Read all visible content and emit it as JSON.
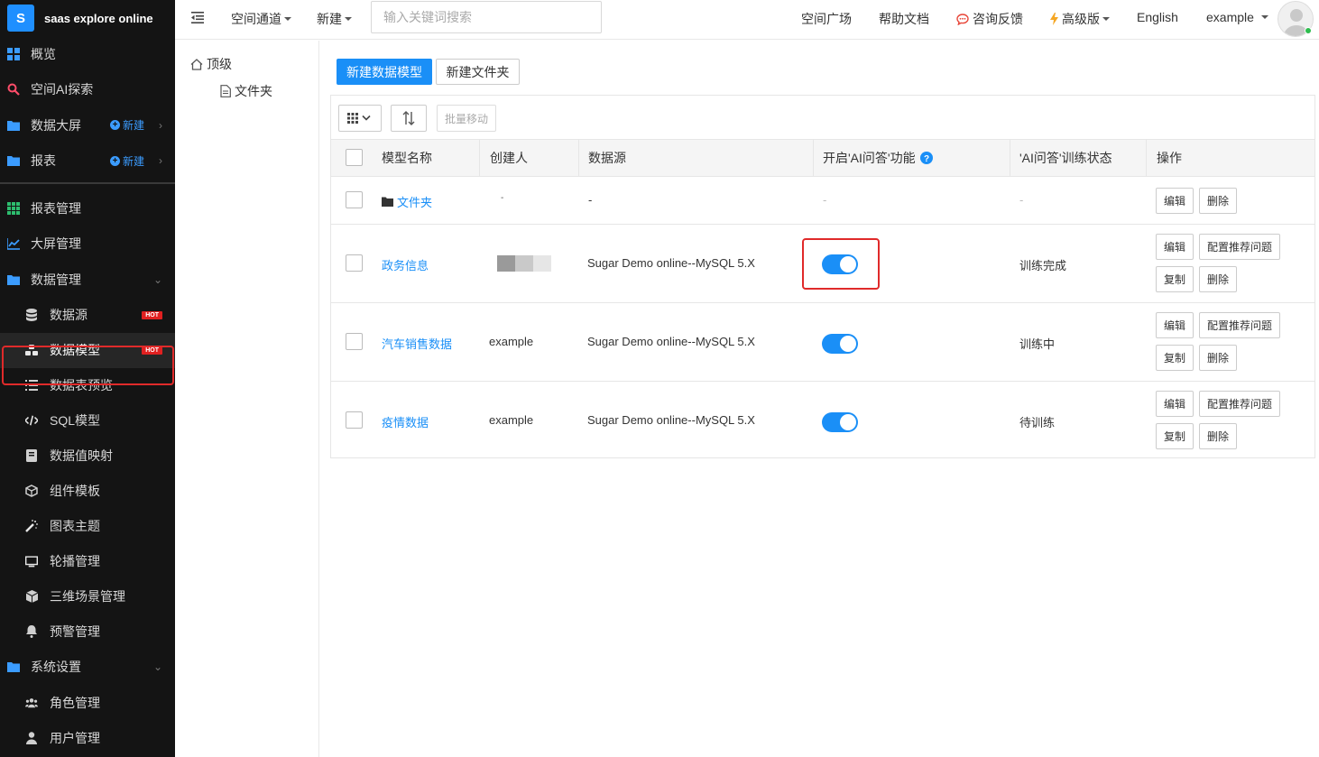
{
  "sidebar": {
    "brand": {
      "logo": "S",
      "name": "saas explore online"
    },
    "group1": [
      {
        "label": "概览",
        "icon": "grid-icon"
      },
      {
        "label": "空间AI探索",
        "icon": "search-icon"
      },
      {
        "label": "数据大屏",
        "icon": "folder-icon",
        "new_label": "新建"
      },
      {
        "label": "报表",
        "icon": "folder-icon",
        "new_label": "新建"
      }
    ],
    "group2": [
      {
        "label": "报表管理",
        "icon": "grid-icon"
      },
      {
        "label": "大屏管理",
        "icon": "chart-icon"
      },
      {
        "label": "数据管理",
        "icon": "folder-icon"
      }
    ],
    "data_sub": [
      {
        "label": "数据源",
        "icon": "database-icon",
        "badge": "HOT"
      },
      {
        "label": "数据模型",
        "icon": "cubes-icon",
        "badge": "HOT"
      },
      {
        "label": "数据表预览",
        "icon": "list-icon"
      },
      {
        "label": "SQL模型",
        "icon": "code-icon"
      },
      {
        "label": "数据值映射",
        "icon": "book-icon"
      },
      {
        "label": "组件模板",
        "icon": "cube-outline-icon"
      },
      {
        "label": "图表主题",
        "icon": "magic-icon"
      },
      {
        "label": "轮播管理",
        "icon": "monitor-icon"
      },
      {
        "label": "三维场景管理",
        "icon": "box-icon"
      },
      {
        "label": "预警管理",
        "icon": "bell-icon"
      }
    ],
    "settings": {
      "label": "系统设置",
      "icon": "folder-icon"
    },
    "settings_sub": [
      {
        "label": "角色管理",
        "icon": "users-icon"
      },
      {
        "label": "用户管理",
        "icon": "user-icon"
      }
    ]
  },
  "topbar": {
    "space_channel": "空间通道",
    "new": "新建",
    "search_placeholder": "输入关键词搜索",
    "space_square": "空间广场",
    "help_docs": "帮助文档",
    "feedback": "咨询反馈",
    "premium": "高级版",
    "language": "English",
    "user": "example"
  },
  "tree": {
    "root": "顶级",
    "child": "文件夹"
  },
  "main": {
    "new_model_btn": "新建数据模型",
    "new_folder_btn": "新建文件夹",
    "batch_move": "批量移动",
    "columns": [
      "模型名称",
      "创建人",
      "数据源",
      "开启'AI问答'功能",
      "'AI问答'训练状态",
      "操作"
    ],
    "rows": [
      {
        "name": "文件夹",
        "creator": "-",
        "source": "-",
        "ai": "-",
        "status": "-",
        "actions": [
          "编辑",
          "删除"
        ]
      },
      {
        "name": "政务信息",
        "creator": "",
        "source": "Sugar Demo online--MySQL 5.X",
        "status": "训练完成",
        "actions": [
          "编辑",
          "配置推荐问题",
          "复制",
          "删除"
        ]
      },
      {
        "name": "汽车销售数据",
        "creator": "example",
        "source": "Sugar Demo online--MySQL 5.X",
        "status": "训练中",
        "actions": [
          "编辑",
          "配置推荐问题",
          "复制",
          "删除"
        ]
      },
      {
        "name": "疫情数据",
        "creator": "example",
        "source": "Sugar Demo online--MySQL 5.X",
        "status": "待训练",
        "actions": [
          "编辑",
          "配置推荐问题",
          "复制",
          "删除"
        ]
      }
    ]
  },
  "colors": {
    "accent": "#1a8ff7",
    "highlight": "#e02a2a",
    "sidebar_bg": "#141414"
  }
}
